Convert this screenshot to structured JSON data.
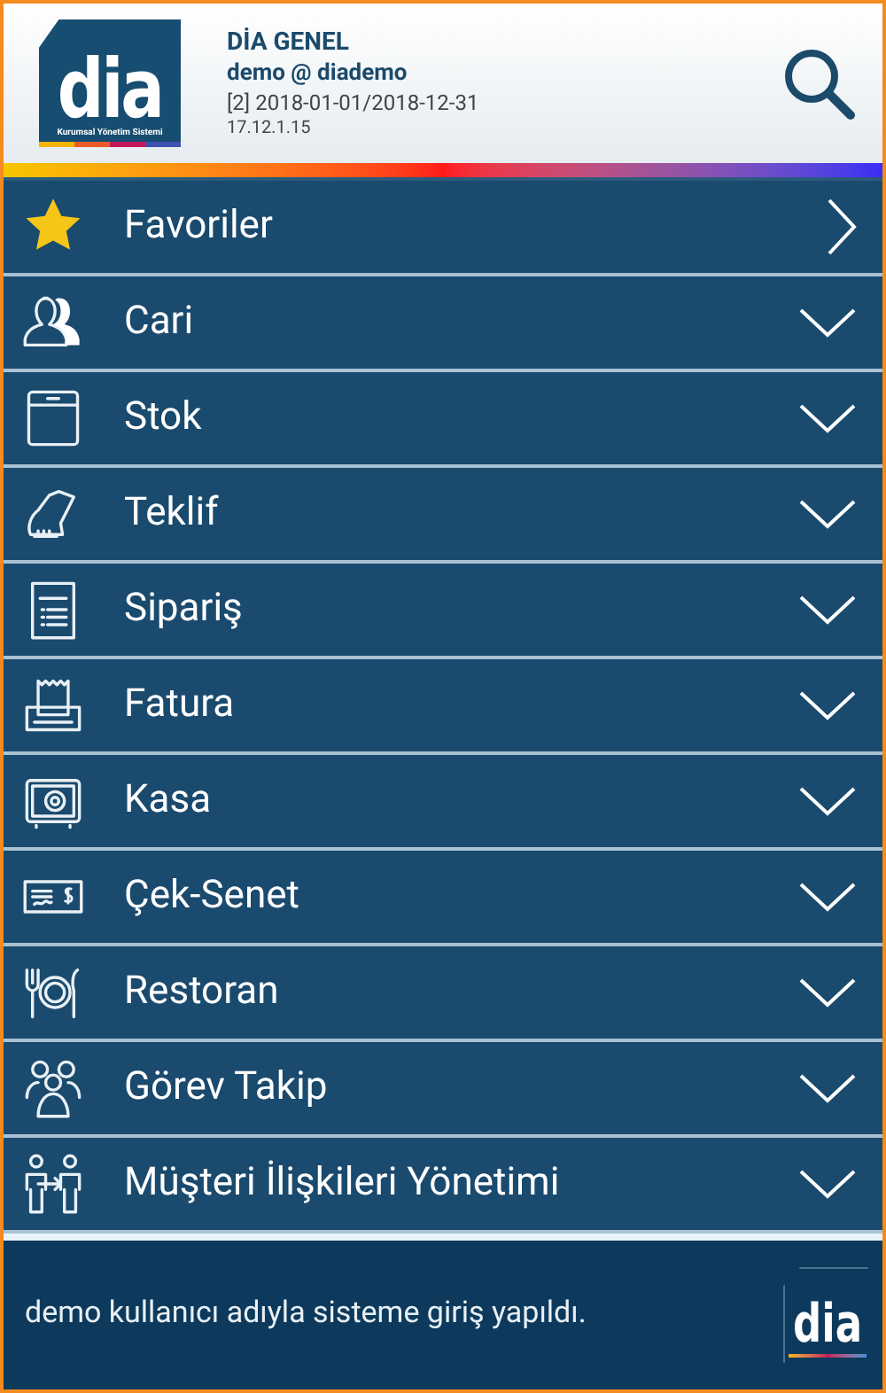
{
  "header": {
    "logo": {
      "text": "dia",
      "tagline": "Kurumsal Yönetim Sistemi"
    },
    "title": "DİA GENEL",
    "user": "demo @ diademo",
    "period": "[2] 2018-01-01/2018-12-31",
    "version": "17.12.1.15"
  },
  "menu": [
    {
      "label": "Favoriler",
      "kind": "link"
    },
    {
      "label": "Cari",
      "kind": "group",
      "expanded": false
    },
    {
      "label": "Stok",
      "kind": "group",
      "expanded": false
    },
    {
      "label": "Teklif",
      "kind": "group",
      "expanded": false
    },
    {
      "label": "Sipariş",
      "kind": "group",
      "expanded": false
    },
    {
      "label": "Fatura",
      "kind": "group",
      "expanded": false
    },
    {
      "label": "Kasa",
      "kind": "group",
      "expanded": false
    },
    {
      "label": "Çek-Senet",
      "kind": "group",
      "expanded": false
    },
    {
      "label": "Restoran",
      "kind": "group",
      "expanded": false
    },
    {
      "label": "Görev Takip",
      "kind": "group",
      "expanded": false
    },
    {
      "label": "Müşteri İlişkileri Yönetimi",
      "kind": "group",
      "expanded": false
    }
  ],
  "status_bar": {
    "message": "demo kullanıcı adıyla sisteme giriş yapıldı.",
    "logo": "dia"
  }
}
